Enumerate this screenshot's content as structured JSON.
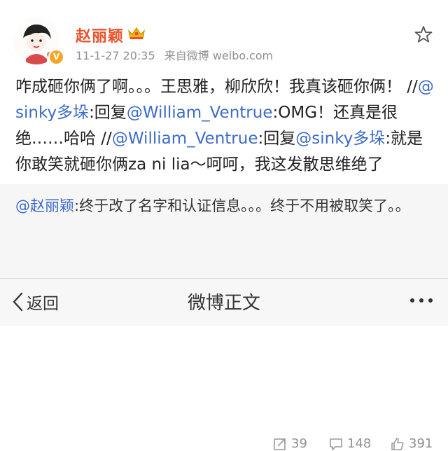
{
  "user": {
    "name": "赵丽颖",
    "verified_badge": "V",
    "time": "11-1-27 20:35",
    "source": "来自微博 weibo.com"
  },
  "post": {
    "segments": [
      {
        "text": "咋成砸你俩了啊。。。王思雅，柳欣欣！我真该砸你俩！ //",
        "type": "plain"
      },
      {
        "text": "@sinky多垛",
        "type": "mention"
      },
      {
        "text": ":回复",
        "type": "plain"
      },
      {
        "text": "@William_Ventrue",
        "type": "mention"
      },
      {
        "text": ":OMG！还真是很绝……哈哈 //",
        "type": "plain"
      },
      {
        "text": "@William_Ventrue",
        "type": "mention"
      },
      {
        "text": ":回复",
        "type": "plain"
      },
      {
        "text": "@sinky多垛",
        "type": "mention"
      },
      {
        "text": ":就是你敢笑就砸你俩za ni lia～呵呵，我这发散思维绝了",
        "type": "plain"
      }
    ]
  },
  "repost": {
    "mention": "@赵丽颖",
    "text": ":终于改了名字和认证信息。。。终于不用被取笑了。。"
  },
  "stats": {
    "reposts": "39",
    "comments": "148",
    "likes": "391"
  },
  "bottom_bar": {
    "back_label": "返回",
    "title": "微博正文"
  },
  "colors": {
    "username": "#e8532a",
    "mention": "#3d6cc6",
    "meta": "#909090",
    "repost_bg": "#f6f6f6"
  },
  "icons": [
    "crown-icon",
    "star-icon",
    "repost-icon",
    "comment-icon",
    "like-icon",
    "back-chevron-icon",
    "more-icon"
  ]
}
